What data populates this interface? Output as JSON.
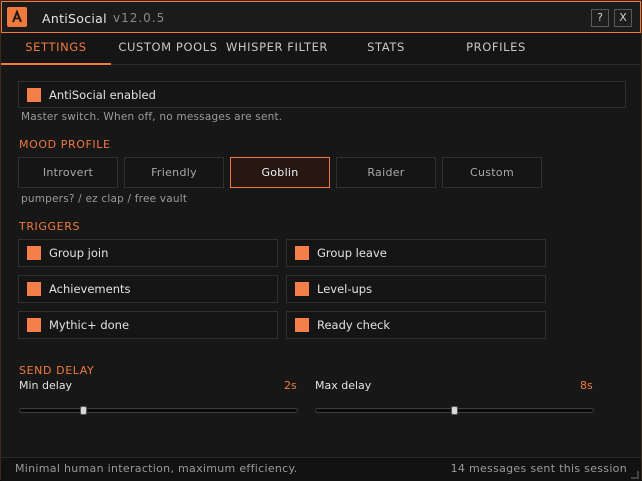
{
  "window": {
    "title": "AntiSocial",
    "version": "v12.0.5",
    "help_label": "?",
    "close_label": "X"
  },
  "tabs": [
    {
      "label": "SETTINGS",
      "active": true
    },
    {
      "label": "CUSTOM POOLS",
      "active": false
    },
    {
      "label": "WHISPER FILTER",
      "active": false
    },
    {
      "label": "STATS",
      "active": false
    },
    {
      "label": "PROFILES",
      "active": false
    }
  ],
  "master": {
    "label": "AntiSocial enabled",
    "checked": true,
    "hint": "Master switch. When off, no messages are sent."
  },
  "mood": {
    "section": "MOOD PROFILE",
    "options": [
      "Introvert",
      "Friendly",
      "Goblin",
      "Raider",
      "Custom"
    ],
    "selected": "Goblin",
    "hint": "pumpers? / ez clap / free vault"
  },
  "triggers": {
    "section": "TRIGGERS",
    "items": [
      {
        "label": "Group join",
        "checked": true
      },
      {
        "label": "Group leave",
        "checked": true
      },
      {
        "label": "Achievements",
        "checked": true
      },
      {
        "label": "Level-ups",
        "checked": true
      },
      {
        "label": "Mythic+ done",
        "checked": true
      },
      {
        "label": "Ready check",
        "checked": true
      }
    ]
  },
  "delay": {
    "section": "SEND DELAY",
    "min": {
      "label": "Min delay",
      "value": "2s",
      "fraction": 0.23
    },
    "max": {
      "label": "Max delay",
      "value": "8s",
      "fraction": 0.5
    }
  },
  "footer": {
    "left": "Minimal human interaction, maximum efficiency.",
    "right": "14 messages sent this session"
  },
  "colors": {
    "accent": "#f07a3e",
    "checkbox": "#f47f48",
    "background": "#171717"
  }
}
